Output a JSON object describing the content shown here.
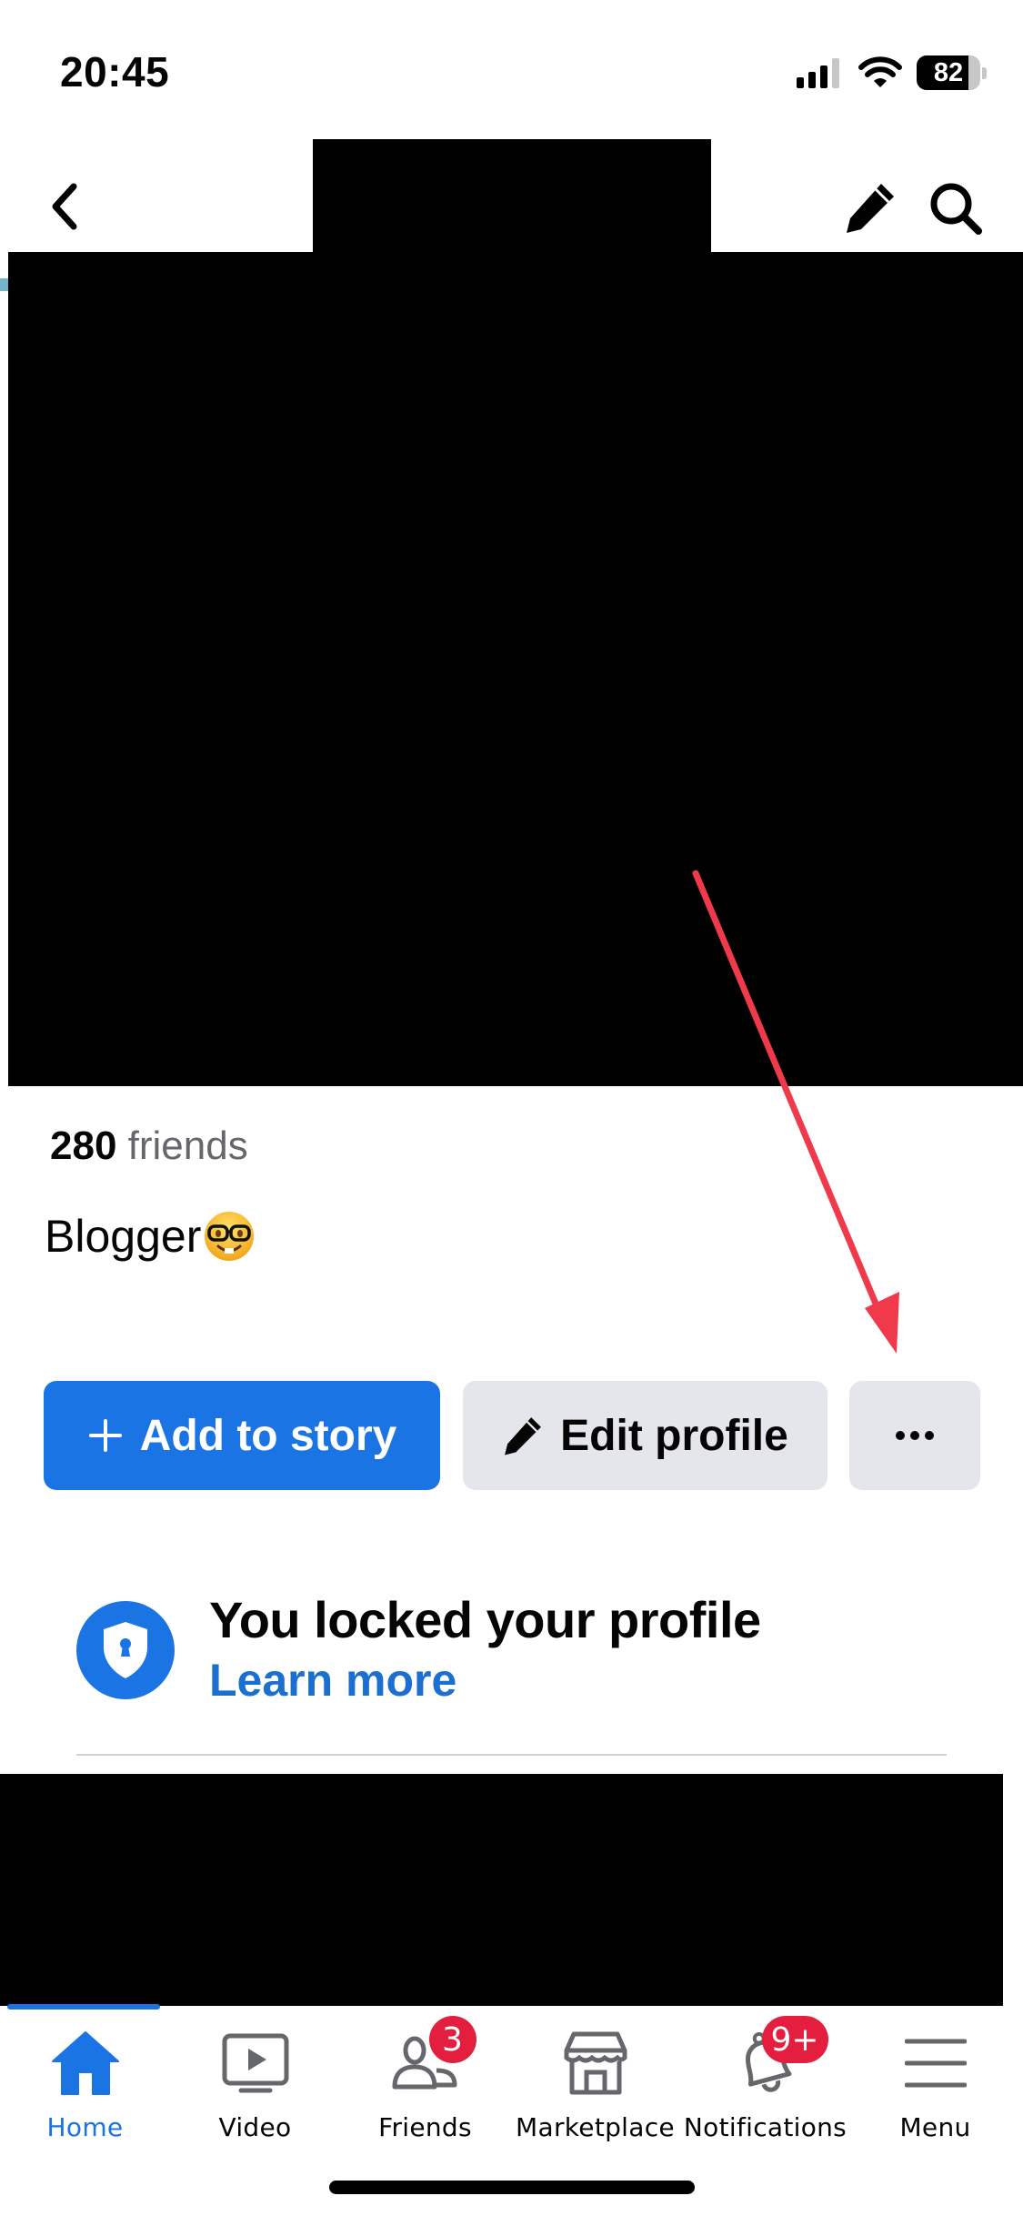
{
  "status_bar": {
    "time": "20:45",
    "battery_percent": "82",
    "battery_level": 0.82
  },
  "nav": {
    "back_icon": "chevron-left-icon",
    "edit_icon": "pencil-icon",
    "search_icon": "search-icon"
  },
  "profile": {
    "friends_count": "280",
    "friends_label": "friends",
    "bio": "Blogger",
    "bio_emoji": "nerd-face-emoji"
  },
  "actions": {
    "add_to_story": "Add to story",
    "edit_profile": "Edit profile",
    "more": "···"
  },
  "locked_notice": {
    "title": "You locked your profile",
    "link": "Learn more",
    "icon": "shield-keyhole-icon"
  },
  "colors": {
    "brand_blue": "#1b74e4",
    "link_blue": "#1b6fd0",
    "badge_red": "#e41e3f",
    "annotation_red": "#f03a4c",
    "secondary_button": "#e4e6eb"
  },
  "tabbar": {
    "items": [
      {
        "label": "Home",
        "icon": "home-icon",
        "active": true
      },
      {
        "label": "Video",
        "icon": "video-icon"
      },
      {
        "label": "Friends",
        "icon": "friends-icon",
        "badge": "3"
      },
      {
        "label": "Marketplace",
        "icon": "marketplace-icon"
      },
      {
        "label": "Notifications",
        "icon": "bell-icon",
        "badge": "9+"
      },
      {
        "label": "Menu",
        "icon": "menu-icon"
      }
    ]
  }
}
